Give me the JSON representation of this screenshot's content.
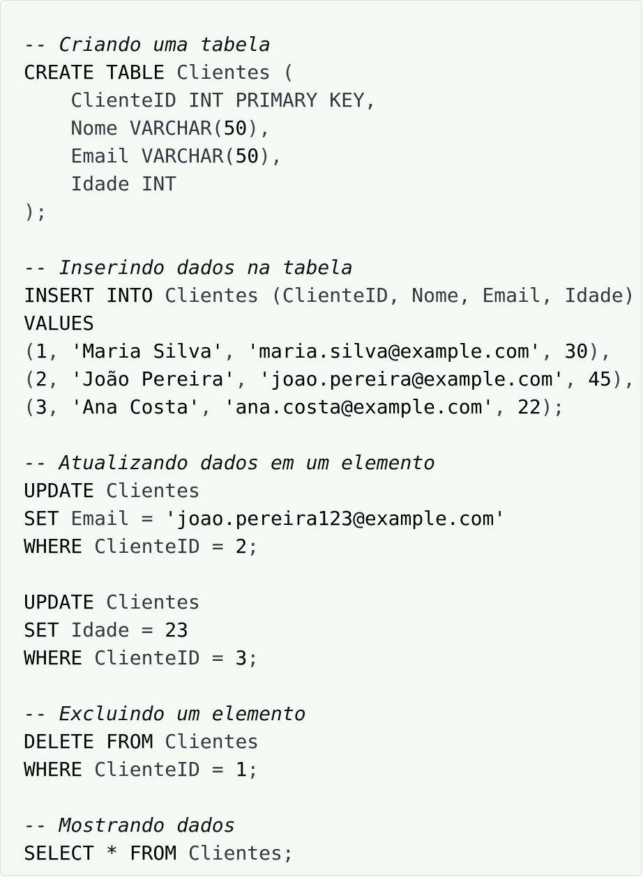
{
  "editor": {
    "lines": [
      [
        {
          "t": "-- Criando uma tabela",
          "c": "comment"
        }
      ],
      [
        {
          "t": "CREATE TABLE",
          "c": "kw"
        },
        {
          "t": " Clientes (",
          "c": "id"
        }
      ],
      [
        {
          "t": "    ClienteID INT PRIMARY KEY,",
          "c": "id"
        }
      ],
      [
        {
          "t": "    Nome VARCHAR(",
          "c": "id"
        },
        {
          "t": "50",
          "c": "num"
        },
        {
          "t": "),",
          "c": "punct"
        }
      ],
      [
        {
          "t": "    Email VARCHAR(",
          "c": "id"
        },
        {
          "t": "50",
          "c": "num"
        },
        {
          "t": "),",
          "c": "punct"
        }
      ],
      [
        {
          "t": "    Idade INT",
          "c": "id"
        }
      ],
      [
        {
          "t": ");",
          "c": "punct"
        }
      ],
      [],
      [
        {
          "t": "-- Inserindo dados na tabela",
          "c": "comment"
        }
      ],
      [
        {
          "t": "INSERT INTO",
          "c": "kw"
        },
        {
          "t": " Clientes (ClienteID, Nome, Email, Idade)",
          "c": "id"
        }
      ],
      [
        {
          "t": "VALUES",
          "c": "kw"
        }
      ],
      [
        {
          "t": "(",
          "c": "punct"
        },
        {
          "t": "1",
          "c": "num"
        },
        {
          "t": ", ",
          "c": "punct"
        },
        {
          "t": "'Maria Silva'",
          "c": "str"
        },
        {
          "t": ", ",
          "c": "punct"
        },
        {
          "t": "'maria.silva@example.com'",
          "c": "str"
        },
        {
          "t": ", ",
          "c": "punct"
        },
        {
          "t": "30",
          "c": "num"
        },
        {
          "t": "),",
          "c": "punct"
        }
      ],
      [
        {
          "t": "(",
          "c": "punct"
        },
        {
          "t": "2",
          "c": "num"
        },
        {
          "t": ", ",
          "c": "punct"
        },
        {
          "t": "'João Pereira'",
          "c": "str"
        },
        {
          "t": ", ",
          "c": "punct"
        },
        {
          "t": "'joao.pereira@example.com'",
          "c": "str"
        },
        {
          "t": ", ",
          "c": "punct"
        },
        {
          "t": "45",
          "c": "num"
        },
        {
          "t": "),",
          "c": "punct"
        }
      ],
      [
        {
          "t": "(",
          "c": "punct"
        },
        {
          "t": "3",
          "c": "num"
        },
        {
          "t": ", ",
          "c": "punct"
        },
        {
          "t": "'Ana Costa'",
          "c": "str"
        },
        {
          "t": ", ",
          "c": "punct"
        },
        {
          "t": "'ana.costa@example.com'",
          "c": "str"
        },
        {
          "t": ", ",
          "c": "punct"
        },
        {
          "t": "22",
          "c": "num"
        },
        {
          "t": ");",
          "c": "punct"
        }
      ],
      [],
      [
        {
          "t": "-- Atualizando dados em um elemento",
          "c": "comment"
        }
      ],
      [
        {
          "t": "UPDATE",
          "c": "kw"
        },
        {
          "t": " Clientes",
          "c": "id"
        }
      ],
      [
        {
          "t": "SET",
          "c": "kw"
        },
        {
          "t": " Email = ",
          "c": "id"
        },
        {
          "t": "'joao.pereira123@example.com'",
          "c": "str"
        }
      ],
      [
        {
          "t": "WHERE",
          "c": "kw"
        },
        {
          "t": " ClienteID = ",
          "c": "id"
        },
        {
          "t": "2",
          "c": "num"
        },
        {
          "t": ";",
          "c": "punct"
        }
      ],
      [],
      [
        {
          "t": "UPDATE",
          "c": "kw"
        },
        {
          "t": " Clientes",
          "c": "id"
        }
      ],
      [
        {
          "t": "SET",
          "c": "kw"
        },
        {
          "t": " Idade = ",
          "c": "id"
        },
        {
          "t": "23",
          "c": "num"
        }
      ],
      [
        {
          "t": "WHERE",
          "c": "kw"
        },
        {
          "t": " ClienteID = ",
          "c": "id"
        },
        {
          "t": "3",
          "c": "num"
        },
        {
          "t": ";",
          "c": "punct"
        }
      ],
      [],
      [
        {
          "t": "-- Excluindo um elemento",
          "c": "comment"
        }
      ],
      [
        {
          "t": "DELETE FROM",
          "c": "kw"
        },
        {
          "t": " Clientes",
          "c": "id"
        }
      ],
      [
        {
          "t": "WHERE",
          "c": "kw"
        },
        {
          "t": " ClienteID = ",
          "c": "id"
        },
        {
          "t": "1",
          "c": "num"
        },
        {
          "t": ";",
          "c": "punct"
        }
      ],
      [],
      [
        {
          "t": "-- Mostrando dados",
          "c": "comment"
        }
      ],
      [
        {
          "t": "SELECT * FROM",
          "c": "kw"
        },
        {
          "t": " Clientes;",
          "c": "id"
        }
      ]
    ]
  },
  "theme": {
    "background": "#f4fbf5",
    "border": "#d9dfda",
    "comment": "#111111",
    "keyword": "#000000",
    "identifier": "#33383e"
  }
}
